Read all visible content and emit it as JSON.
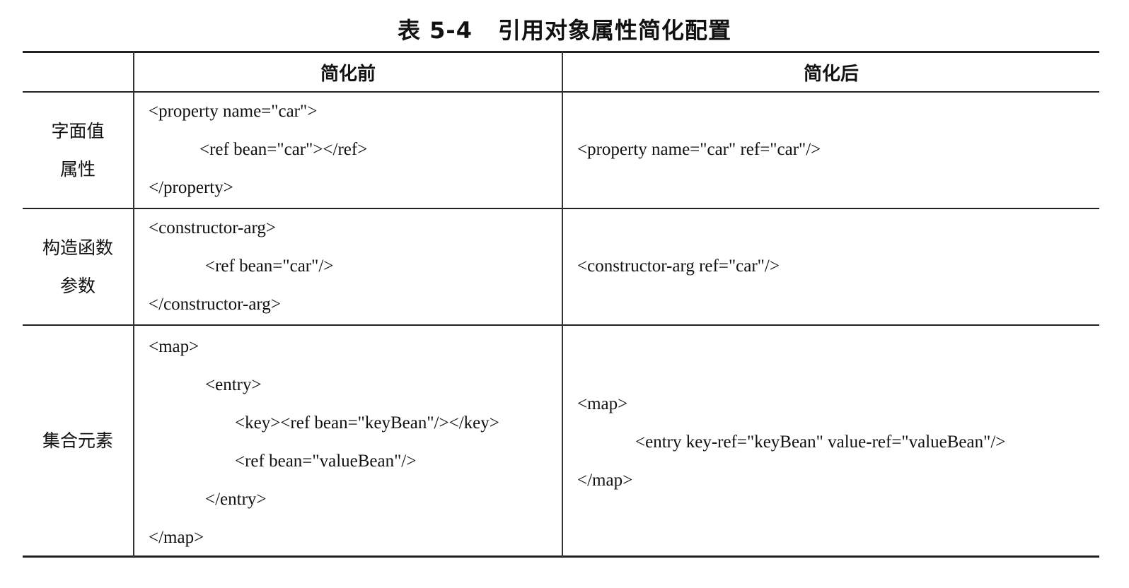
{
  "caption": {
    "number": "表 5-4",
    "title": "引用对象属性简化配置"
  },
  "table": {
    "headers": [
      "",
      "简化前",
      "简化后"
    ],
    "rows": [
      {
        "label": [
          "字面值",
          "属性"
        ],
        "before": [
          "<property name=\"car\">",
          "<ref bean=\"car\"></ref>",
          "</property>"
        ],
        "after": [
          "<property name=\"car\" ref=\"car\"/>"
        ]
      },
      {
        "label": [
          "构造函数",
          "参数"
        ],
        "before": [
          "<constructor-arg>",
          "<ref bean=\"car\"/>",
          "</constructor-arg>"
        ],
        "after": [
          "<constructor-arg ref=\"car\"/>"
        ]
      },
      {
        "label": [
          "集合元素"
        ],
        "before": [
          "<map>",
          "<entry>",
          "<key><ref bean=\"keyBean\"/></key>",
          "<ref bean=\"valueBean\"/>",
          "</entry>",
          "</map>"
        ],
        "after": [
          "<map>",
          "<entry key-ref=\"keyBean\" value-ref=\"valueBean\"/>",
          "</map>"
        ]
      }
    ]
  }
}
